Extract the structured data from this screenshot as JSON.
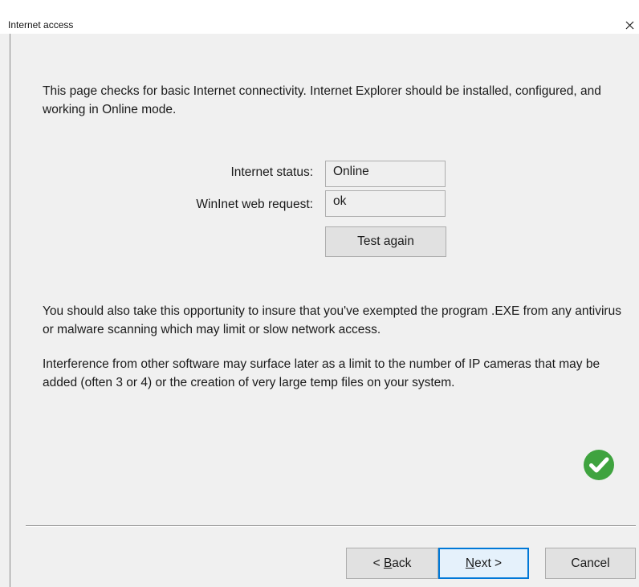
{
  "window": {
    "title": "Internet access",
    "close_glyph": "×"
  },
  "intro": {
    "text": "This page checks for basic Internet connectivity.  Internet Explorer should be installed, configured, and working in Online mode."
  },
  "status": {
    "internet_label": "Internet status:",
    "internet_value": "Online",
    "winnet_label": "WinInet web request:",
    "winnet_value": "ok",
    "test_again_label": "Test again"
  },
  "advice": {
    "antivirus": "You should also take this opportunity to insure that you've exempted the program .EXE from any antivirus or malware scanning which may limit or slow network access.",
    "interference": "Interference from other software may surface later as a limit to the number of IP cameras that may be added (often 3 or 4) or the creation of very large temp files on your system."
  },
  "result_icon": "check-circle-icon",
  "colors": {
    "success": "#3fa33f",
    "focus": "#0078d7",
    "dialog_bg": "#f0f0f0"
  },
  "buttons": {
    "back_prefix": "< ",
    "back_mnemonic": "B",
    "back_rest": "ack",
    "next_mnemonic": "N",
    "next_rest": "ext >",
    "cancel": "Cancel"
  }
}
